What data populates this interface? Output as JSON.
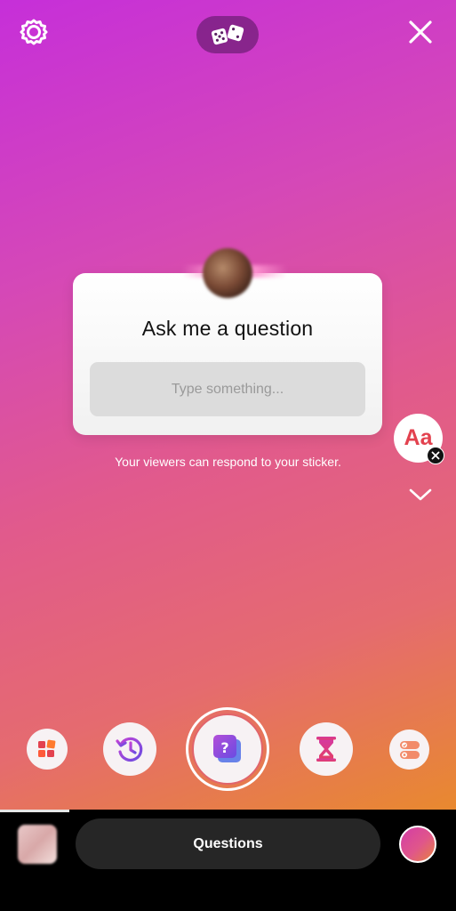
{
  "top_bar": {
    "settings_icon": "gear-icon",
    "dice_icon": "dice-icon",
    "close_icon": "close-icon"
  },
  "sticker": {
    "title": "Ask me a question",
    "input_placeholder": "Type something...",
    "avatar": "profile-avatar"
  },
  "hint": "Your viewers can respond to your sticker.",
  "side_controls": {
    "text_style_label": "Aa",
    "remove_icon": "close-icon",
    "expand_icon": "chevron-down-icon"
  },
  "carousel": [
    {
      "name": "layout",
      "icon": "layout-icon"
    },
    {
      "name": "history",
      "icon": "history-icon"
    },
    {
      "name": "questions",
      "icon": "question-sticker-icon",
      "selected": true
    },
    {
      "name": "countdown",
      "icon": "hourglass-icon"
    },
    {
      "name": "poll",
      "icon": "poll-icon"
    }
  ],
  "bottom_bar": {
    "mode_label": "Questions",
    "gallery_icon": "gallery-thumbnail",
    "color_picker": "color-picker"
  },
  "colors": {
    "gradient_top": "#c62fd9",
    "gradient_bottom": "#e8892f",
    "accent_red": "#e3424f",
    "question_purple": "#8a4be3"
  }
}
